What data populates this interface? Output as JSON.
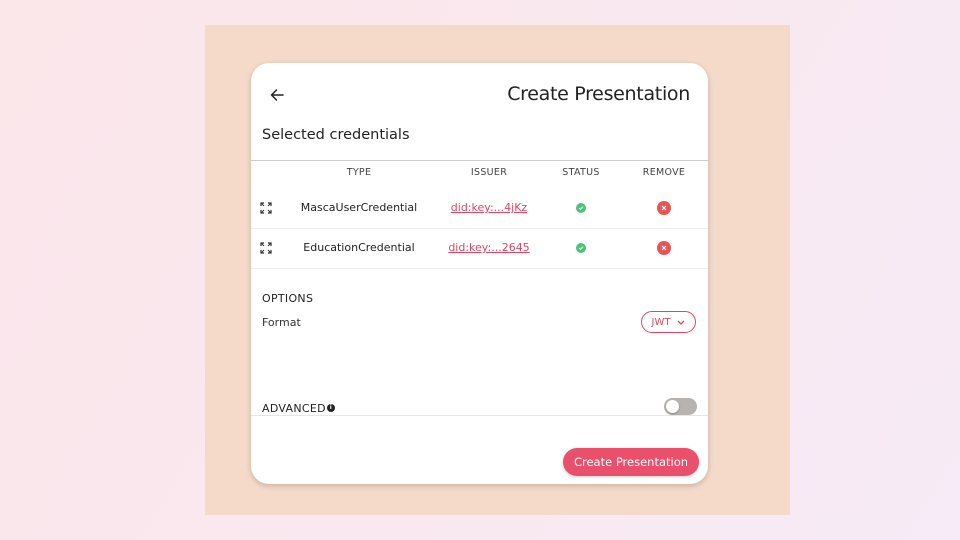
{
  "header": {
    "title": "Create Presentation"
  },
  "section": {
    "title": "Selected credentials"
  },
  "table": {
    "headers": [
      "TYPE",
      "ISSUER",
      "STATUS",
      "REMOVE"
    ],
    "rows": [
      {
        "type": "MascaUserCredential",
        "issuer": "did:key:...4jKz"
      },
      {
        "type": "EducationCredential",
        "issuer": "did:key:...2645"
      }
    ]
  },
  "options": {
    "title": "OPTIONS",
    "format_label": "Format",
    "format_value": "JWT"
  },
  "advanced": {
    "title": "ADVANCED",
    "enabled": false
  },
  "actions": {
    "create_label": "Create Presentation"
  },
  "colors": {
    "accent": "#ea4f6b",
    "valid": "#4cc478",
    "remove": "#e85451",
    "background": "#f5d9c9"
  }
}
